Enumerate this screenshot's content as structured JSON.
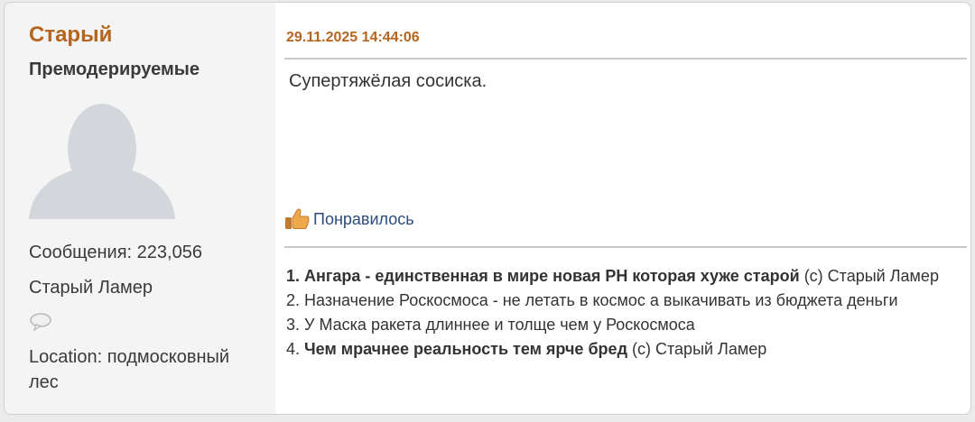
{
  "user": {
    "name": "Старый",
    "group": "Премодерируемые",
    "messages": "Сообщения: 223,056",
    "title": "Старый Ламер",
    "location": "Location: подмосковный лес"
  },
  "post": {
    "date": "29.11.2025 14:44:06",
    "text": "Супертяжёлая сосиска.",
    "likes_label": "Понравилось"
  },
  "signature": {
    "line1_num": "1.",
    "line1_bold": "Ангара - единственная в мире новая РН которая хуже старой",
    "line1_rest": "(с) Старый Ламер",
    "line2": "2. Назначение Роскосмоса - не летать в космос а выкачивать из бюджета деньги",
    "line3": "3. У Маска ракета длиннее и толще чем у Роскосмоса",
    "line4_num": "4.",
    "line4_bold": "Чем мрачнее реальность тем ярче бред",
    "line4_rest": "(с) Старый Ламер"
  },
  "colors": {
    "username": "#b5651d",
    "date": "#b5651d",
    "link": "#2b4b7c",
    "avatar": "#d3d6db"
  },
  "icons": {
    "avatar": "default-avatar-icon",
    "message": "speech-bubble-icon",
    "like": "thumbs-up-icon"
  }
}
